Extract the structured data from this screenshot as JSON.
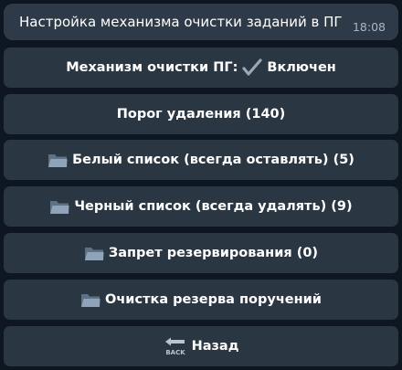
{
  "message": {
    "text": "Настройка механизма очистки заданий в ПГ",
    "time": "18:08"
  },
  "keyboard": {
    "mechanism": {
      "prefix": "Механизм очистки ПГ:",
      "status": "Включен",
      "icon": "checkmark-icon"
    },
    "threshold": {
      "label": "Порог удаления (140)"
    },
    "whitelist": {
      "label": "Белый список (всегда оставлять) (5)",
      "icon": "folder-icon"
    },
    "blacklist": {
      "label": "Черный список (всегда удалять) (9)",
      "icon": "folder-icon"
    },
    "reserve_ban": {
      "label": "Запрет резервирования (0)",
      "icon": "folder-icon"
    },
    "reserve_cleanup": {
      "label": "Очистка резерва поручений",
      "icon": "folder-icon"
    },
    "back": {
      "label": "Назад",
      "icon": "back-arrow-icon",
      "icon_text": "BACK"
    }
  },
  "colors": {
    "background": "#0e1621",
    "bubble": "#2e3a48",
    "button": "#2b3643",
    "text": "#ffffff",
    "time": "#a9b6c3",
    "folder": "#7d93a8",
    "checkmark": "#9aa7b4"
  }
}
